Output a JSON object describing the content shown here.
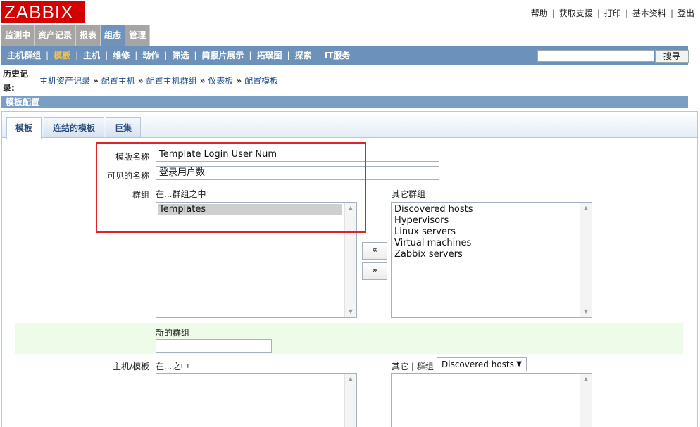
{
  "logo": {
    "text": "ZABBIX",
    "color": "#d40000"
  },
  "top_links": [
    "帮助",
    "获取支援",
    "打印",
    "基本资料",
    "登出"
  ],
  "main_menu": {
    "items": [
      "监测中",
      "资产记录",
      "报表",
      "组态",
      "管理"
    ],
    "active": "组态"
  },
  "sub_menu": {
    "items": [
      "主机群组",
      "模板",
      "主机",
      "维修",
      "动作",
      "筛选",
      "简报片展示",
      "拓璞图",
      "探索",
      "IT服务"
    ],
    "active": "模板",
    "search_button": "搜寻",
    "search_value": ""
  },
  "history": {
    "label": "历史记录:",
    "trail": [
      "主机资产记录",
      "配置主机",
      "配置主机群组",
      "仪表板",
      "配置模板"
    ]
  },
  "section_title": "模板配置",
  "tabs": [
    "模板",
    "连结的模板",
    "巨集"
  ],
  "form": {
    "template_name_label": "模版名称",
    "template_name_value": "Template Login User Num",
    "visible_name_label": "可见的名称",
    "visible_name_value": "登录用户数",
    "groups_label": "群组",
    "in_groups_label": "在...群组之中",
    "in_groups": [
      "Templates"
    ],
    "other_groups_label": "其它群组",
    "other_groups": [
      "Discovered hosts",
      "Hypervisors",
      "Linux servers",
      "Virtual machines",
      "Zabbix servers"
    ],
    "move_left": "«",
    "move_right": "»",
    "new_group_label": "新的群组",
    "new_group_value": "",
    "hosts_label": "主机/模板",
    "in_label": "在...之中",
    "other_label": "其它",
    "group_label": "群组",
    "group_select_value": "Discovered hosts"
  }
}
